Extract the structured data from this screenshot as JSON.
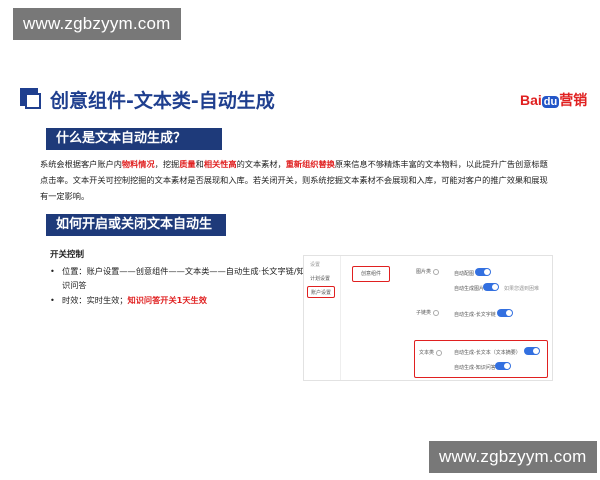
{
  "watermark": {
    "text": "www.zgbzyym.com"
  },
  "slide": {
    "title": "创意组件-文本类-自动生成",
    "logo": {
      "bai": "Bai",
      "du": "du",
      "yingxiao": "营销"
    }
  },
  "section1": {
    "heading": "什么是文本自动生成？",
    "paragraph": [
      {
        "text": "系统会根据客户账户内",
        "hl": false
      },
      {
        "text": "物料情况",
        "hl": true
      },
      {
        "text": "，挖掘",
        "hl": false
      },
      {
        "text": "质量",
        "hl": true
      },
      {
        "text": "和",
        "hl": false
      },
      {
        "text": "相关性高",
        "hl": true
      },
      {
        "text": "的文本素材，",
        "hl": false
      },
      {
        "text": "重新组织替换",
        "hl": true
      },
      {
        "text": "原来信息不够精炼丰富的文本物料，以此提升广告创意标题点击率。文本开关可控制挖掘的文本素材是否展现和入库。若关闭开关，则系统挖掘文本素材不会展现和入库，可能对客户的推广效果和展现有一定影响。",
        "hl": false
      }
    ]
  },
  "section2": {
    "heading": "如何开启或关闭文本自动生成？",
    "control_title": "开关控制",
    "bullet1": "位置：账户设置——创意组件——文本类——自动生成·长文字链/知识问答",
    "bullet2_prefix": "时效：实时生效；",
    "bullet2_highlight": "知识问答开关1天生效"
  },
  "screenshot": {
    "sidebar_title": "设置",
    "sidebar_plan": "计划设置",
    "sidebar_account": "账户设置",
    "tab_creative": "创意组件",
    "image_label": "图片类",
    "image_auto_match": "自动配图",
    "image_auto_gen": "自动生成图片",
    "image_note": "如果您遇到困难",
    "sublink_label": "子链类",
    "sublink_auto": "自动生成-长文字链",
    "text_label": "文本类",
    "text_auto_long": "自动生成-长文本（文本摘要）",
    "text_auto_qa": "自动生成-知识问答"
  }
}
